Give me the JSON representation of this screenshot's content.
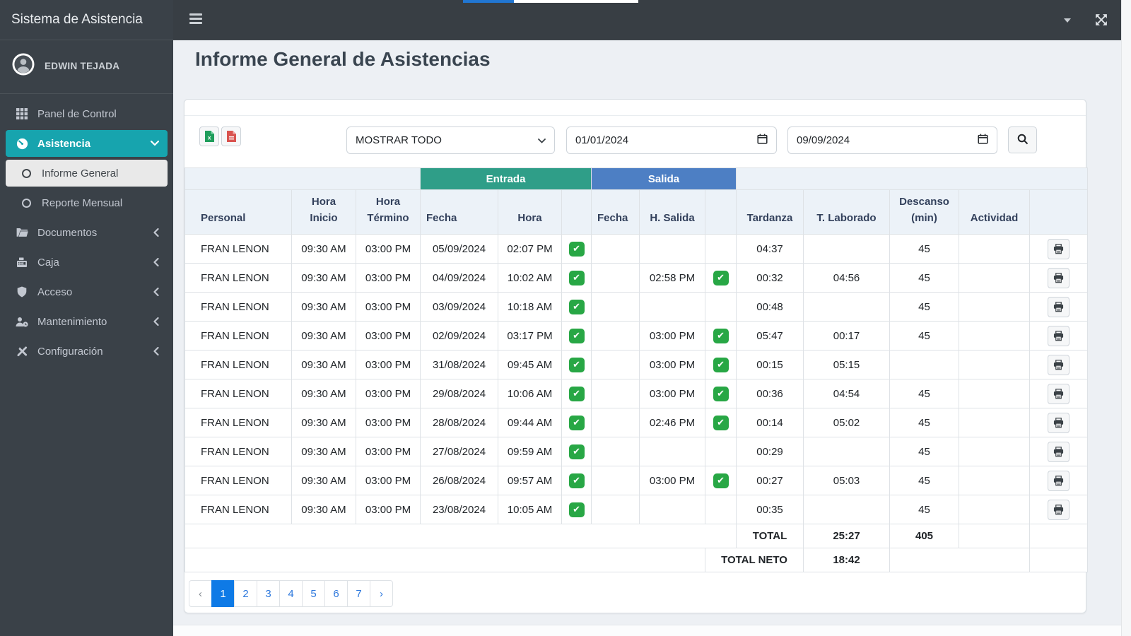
{
  "app": {
    "brand": "Sistema de Asistencia",
    "user_name": "EDWIN TEJADA"
  },
  "sidebar": {
    "items": [
      {
        "label": "Panel de Control"
      },
      {
        "label": "Asistencia"
      },
      {
        "label": "Informe General"
      },
      {
        "label": "Reporte Mensual"
      },
      {
        "label": "Documentos"
      },
      {
        "label": "Caja"
      },
      {
        "label": "Acceso"
      },
      {
        "label": "Mantenimiento"
      },
      {
        "label": "Configuración"
      }
    ]
  },
  "page": {
    "title": "Informe General de Asistencias"
  },
  "toolbar": {
    "filter_value": "MOSTRAR TODO",
    "date_from": "01/01/2024",
    "date_to": "09/09/2024"
  },
  "table": {
    "groups": {
      "entrada": "Entrada",
      "salida": "Salida"
    },
    "columns": [
      "Personal",
      "Hora\nInicio",
      "Hora\nTérmino",
      "Fecha",
      "Hora",
      "",
      "Fecha",
      "H. Salida",
      "",
      "Tardanza",
      "T. Laborado",
      "Descanso\n(min)",
      "Actividad",
      ""
    ],
    "rows": [
      {
        "personal": "FRAN LENON",
        "hora_inicio": "09:30 AM",
        "hora_termino": "03:00 PM",
        "fecha_entrada": "05/09/2024",
        "hora_entrada": "02:07 PM",
        "entrada_ok": true,
        "fecha_salida": "",
        "hora_salida": "",
        "salida_ok": false,
        "tardanza": "04:37",
        "t_laborado": "",
        "descanso": "45",
        "actividad": ""
      },
      {
        "personal": "FRAN LENON",
        "hora_inicio": "09:30 AM",
        "hora_termino": "03:00 PM",
        "fecha_entrada": "04/09/2024",
        "hora_entrada": "10:02 AM",
        "entrada_ok": true,
        "fecha_salida": "",
        "hora_salida": "02:58 PM",
        "salida_ok": true,
        "tardanza": "00:32",
        "t_laborado": "04:56",
        "descanso": "45",
        "actividad": ""
      },
      {
        "personal": "FRAN LENON",
        "hora_inicio": "09:30 AM",
        "hora_termino": "03:00 PM",
        "fecha_entrada": "03/09/2024",
        "hora_entrada": "10:18 AM",
        "entrada_ok": true,
        "fecha_salida": "",
        "hora_salida": "",
        "salida_ok": false,
        "tardanza": "00:48",
        "t_laborado": "",
        "descanso": "45",
        "actividad": ""
      },
      {
        "personal": "FRAN LENON",
        "hora_inicio": "09:30 AM",
        "hora_termino": "03:00 PM",
        "fecha_entrada": "02/09/2024",
        "hora_entrada": "03:17 PM",
        "entrada_ok": true,
        "fecha_salida": "",
        "hora_salida": "03:00 PM",
        "salida_ok": true,
        "tardanza": "05:47",
        "t_laborado": "00:17",
        "descanso": "45",
        "actividad": ""
      },
      {
        "personal": "FRAN LENON",
        "hora_inicio": "09:30 AM",
        "hora_termino": "03:00 PM",
        "fecha_entrada": "31/08/2024",
        "hora_entrada": "09:45 AM",
        "entrada_ok": true,
        "fecha_salida": "",
        "hora_salida": "03:00 PM",
        "salida_ok": true,
        "tardanza": "00:15",
        "t_laborado": "05:15",
        "descanso": "",
        "actividad": ""
      },
      {
        "personal": "FRAN LENON",
        "hora_inicio": "09:30 AM",
        "hora_termino": "03:00 PM",
        "fecha_entrada": "29/08/2024",
        "hora_entrada": "10:06 AM",
        "entrada_ok": true,
        "fecha_salida": "",
        "hora_salida": "03:00 PM",
        "salida_ok": true,
        "tardanza": "00:36",
        "t_laborado": "04:54",
        "descanso": "45",
        "actividad": ""
      },
      {
        "personal": "FRAN LENON",
        "hora_inicio": "09:30 AM",
        "hora_termino": "03:00 PM",
        "fecha_entrada": "28/08/2024",
        "hora_entrada": "09:44 AM",
        "entrada_ok": true,
        "fecha_salida": "",
        "hora_salida": "02:46 PM",
        "salida_ok": true,
        "tardanza": "00:14",
        "t_laborado": "05:02",
        "descanso": "45",
        "actividad": ""
      },
      {
        "personal": "FRAN LENON",
        "hora_inicio": "09:30 AM",
        "hora_termino": "03:00 PM",
        "fecha_entrada": "27/08/2024",
        "hora_entrada": "09:59 AM",
        "entrada_ok": true,
        "fecha_salida": "",
        "hora_salida": "",
        "salida_ok": false,
        "tardanza": "00:29",
        "t_laborado": "",
        "descanso": "45",
        "actividad": ""
      },
      {
        "personal": "FRAN LENON",
        "hora_inicio": "09:30 AM",
        "hora_termino": "03:00 PM",
        "fecha_entrada": "26/08/2024",
        "hora_entrada": "09:57 AM",
        "entrada_ok": true,
        "fecha_salida": "",
        "hora_salida": "03:00 PM",
        "salida_ok": true,
        "tardanza": "00:27",
        "t_laborado": "05:03",
        "descanso": "45",
        "actividad": ""
      },
      {
        "personal": "FRAN LENON",
        "hora_inicio": "09:30 AM",
        "hora_termino": "03:00 PM",
        "fecha_entrada": "23/08/2024",
        "hora_entrada": "10:05 AM",
        "entrada_ok": true,
        "fecha_salida": "",
        "hora_salida": "",
        "salida_ok": false,
        "tardanza": "00:35",
        "t_laborado": "",
        "descanso": "45",
        "actividad": ""
      }
    ],
    "totals": {
      "total_label": "TOTAL",
      "total_t_laborado": "25:27",
      "total_descanso": "405",
      "neto_label": "TOTAL NETO",
      "neto_t_laborado": "18:42"
    }
  },
  "pagination": {
    "prev": "‹",
    "pages": [
      "1",
      "2",
      "3",
      "4",
      "5",
      "6",
      "7"
    ],
    "next": "›",
    "active_page": "1"
  },
  "colors": {
    "sidebar_active": "#17a4ae",
    "entrada_header": "#2f9e88",
    "salida_header": "#4d7fc4",
    "check_green": "#28a745",
    "pagination_active": "#0e7ae6",
    "pagination_link": "#2d78dd",
    "excel_green": "#1f9d5b",
    "pdf_red": "#d9534f",
    "progress_blue": "#2176d2",
    "hdrbg": "#ecf2f8"
  }
}
